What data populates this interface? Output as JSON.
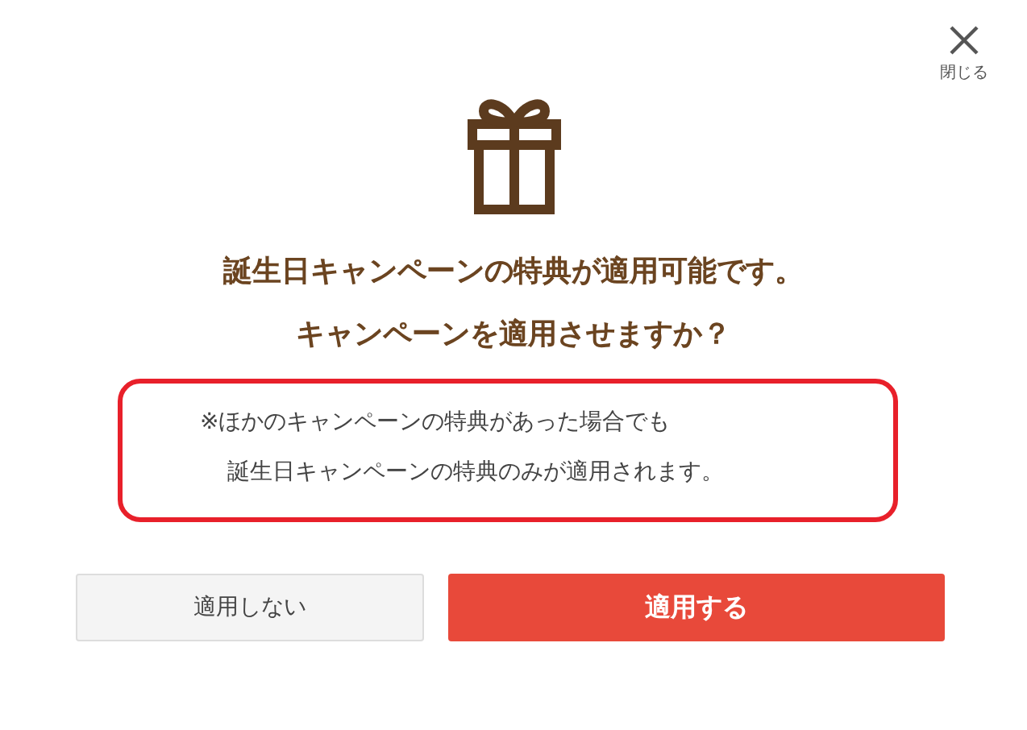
{
  "close": {
    "label": "閉じる"
  },
  "headings": [
    "誕生日キャンペーンの特典が適用可能です。",
    "キャンペーンを適用させますか？"
  ],
  "note_lines": [
    "※ほかのキャンペーンの特典があった場合でも",
    "誕生日キャンペーンの特典のみが適用されます。"
  ],
  "buttons": [
    {
      "label": "適用しない",
      "kind": "secondary"
    },
    {
      "label": "適用する",
      "kind": "primary"
    }
  ]
}
